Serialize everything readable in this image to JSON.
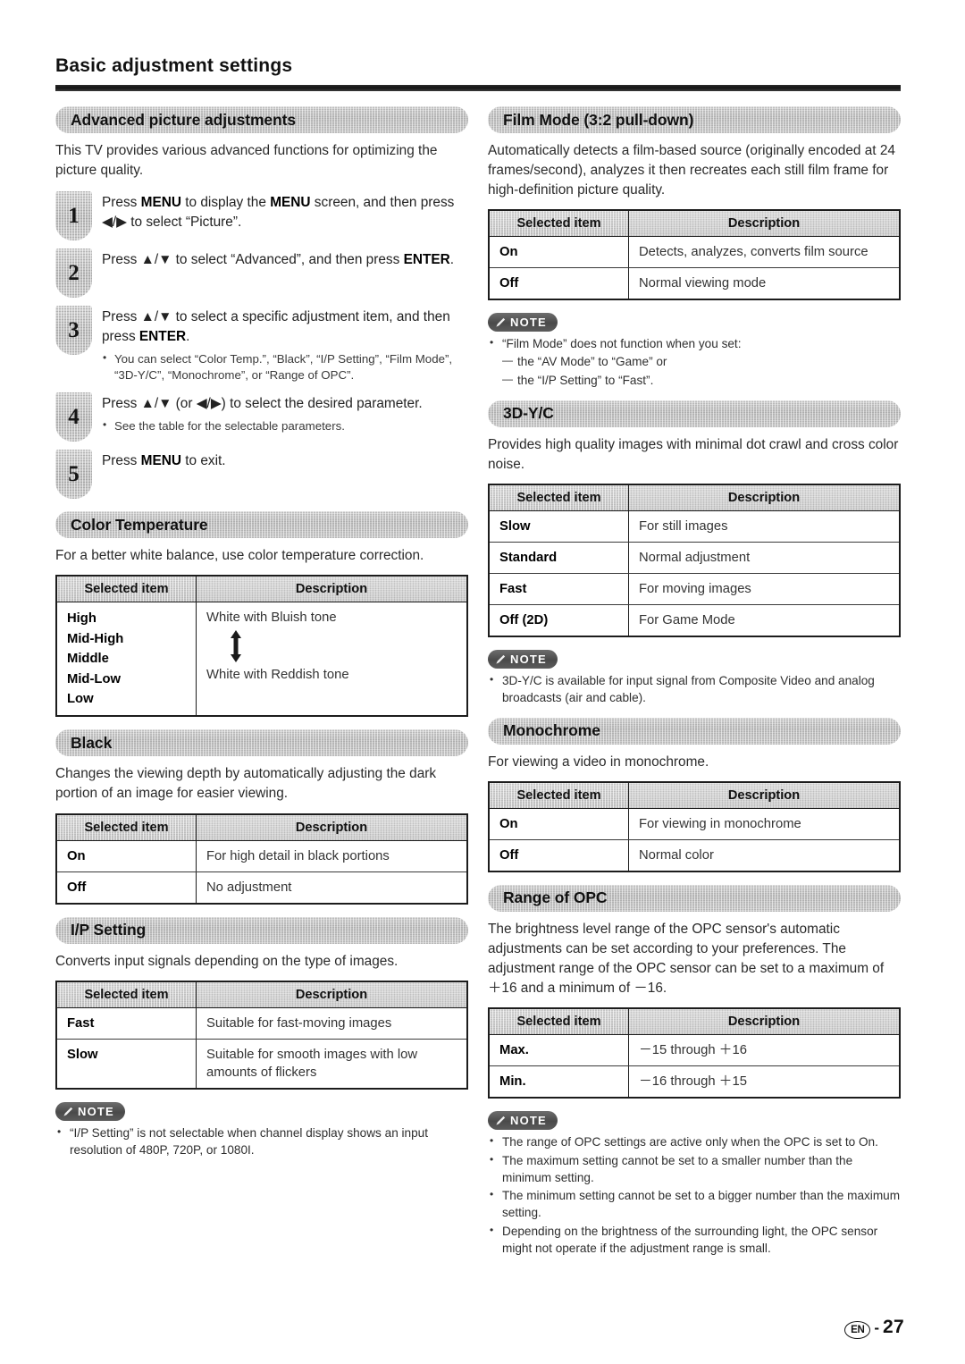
{
  "header": {
    "title": "Basic adjustment settings"
  },
  "footer": {
    "region_mark": "EN",
    "dash": "-",
    "page_number": "27"
  },
  "note_badge_label": "NOTE",
  "table_headers": {
    "col1": "Selected item",
    "col2": "Description"
  },
  "left_column": {
    "advanced": {
      "banner": "Advanced picture adjustments",
      "intro": "This TV provides various advanced functions for optimizing the picture quality.",
      "steps": [
        {
          "number": "1",
          "text_parts": [
            "Press ",
            "MENU",
            " to display the MENU screen, and then press ",
            "◀/▶",
            " to select “Picture”."
          ],
          "text": "Press MENU to display the MENU screen, and then press ◀/▶ to select “Picture”.",
          "subitems": []
        },
        {
          "number": "2",
          "text": "Press ▲/▼ to select “Advanced”, and then press ENTER.",
          "subitems": []
        },
        {
          "number": "3",
          "text": "Press ▲/▼ to select a specific adjustment item, and then press ENTER.",
          "subitems": [
            "You can select “Color Temp.”, “Black”, “I/P Setting”, “Film Mode”, “3D-Y/C”, “Monochrome”, or “Range of OPC”."
          ]
        },
        {
          "number": "4",
          "text": "Press ▲/▼ (or ◀/▶) to select the desired parameter.",
          "subitems": [
            "See the table for the selectable parameters."
          ]
        },
        {
          "number": "5",
          "text": "Press MENU to exit.",
          "subitems": []
        }
      ]
    },
    "color_temperature": {
      "banner": "Color Temperature",
      "intro": "For a better white balance, use color temperature correction.",
      "rows": [
        {
          "items": [
            "High",
            "Mid-High",
            "Middle",
            "Mid-Low",
            "Low"
          ],
          "top_desc": "White with Bluish tone",
          "bottom_desc": "White with Reddish tone"
        }
      ]
    },
    "black": {
      "banner": "Black",
      "intro": "Changes the viewing depth by automatically adjusting the dark portion of an image for easier viewing.",
      "rows": [
        {
          "item": "On",
          "desc": "For high detail in black portions"
        },
        {
          "item": "Off",
          "desc": "No adjustment"
        }
      ]
    },
    "ip_setting": {
      "banner": "I/P Setting",
      "intro": "Converts input signals depending on the type of images.",
      "rows": [
        {
          "item": "Fast",
          "desc": "Suitable for fast-moving images"
        },
        {
          "item": "Slow",
          "desc": "Suitable for smooth images with low amounts of flickers"
        }
      ],
      "note": [
        "“I/P Setting” is not selectable when channel display shows an input resolution of 480P, 720P, or 1080I."
      ]
    }
  },
  "right_column": {
    "film_mode": {
      "banner": "Film Mode (3:2 pull-down)",
      "intro": "Automatically detects a film-based source (originally encoded at 24 frames/second), analyzes it then recreates each still film frame for high-definition picture quality.",
      "rows": [
        {
          "item": "On",
          "desc": "Detects, analyzes, converts film source"
        },
        {
          "item": "Off",
          "desc": "Normal viewing mode"
        }
      ],
      "note_lead": "“Film Mode” does not function when you set:",
      "note_sub": [
        "the “AV Mode” to “Game” or",
        "the “I/P Setting” to “Fast”."
      ]
    },
    "threed_yc": {
      "banner": "3D-Y/C",
      "intro": "Provides high quality images with minimal dot crawl and cross color noise.",
      "rows": [
        {
          "item": "Slow",
          "desc": "For still images"
        },
        {
          "item": "Standard",
          "desc": "Normal adjustment"
        },
        {
          "item": "Fast",
          "desc": "For moving images"
        },
        {
          "item": "Off (2D)",
          "desc": "For Game Mode"
        }
      ],
      "note": [
        "3D-Y/C is available for input signal from Composite Video and analog broadcasts (air and cable)."
      ]
    },
    "monochrome": {
      "banner": "Monochrome",
      "intro": "For viewing a video in monochrome.",
      "rows": [
        {
          "item": "On",
          "desc": "For viewing in monochrome"
        },
        {
          "item": "Off",
          "desc": "Normal color"
        }
      ]
    },
    "range_of_opc": {
      "banner": "Range of OPC",
      "intro": "The brightness level range of the OPC sensor's automatic adjustments can be set according to your preferences. The adjustment range of the OPC sensor can be set to a maximum of ＋16 and a minimum of －16.",
      "rows": [
        {
          "item": "Max.",
          "desc": "－15 through ＋16"
        },
        {
          "item": "Min.",
          "desc": "－16 through ＋15"
        }
      ],
      "note": [
        "The range of OPC settings are active only when the OPC is set to On.",
        "The maximum setting cannot be set to a smaller number than the minimum setting.",
        "The minimum setting cannot be set to a bigger number than the maximum setting.",
        "Depending on the brightness of the surrounding light, the OPC sensor might not operate if the adjustment range is small."
      ]
    }
  }
}
